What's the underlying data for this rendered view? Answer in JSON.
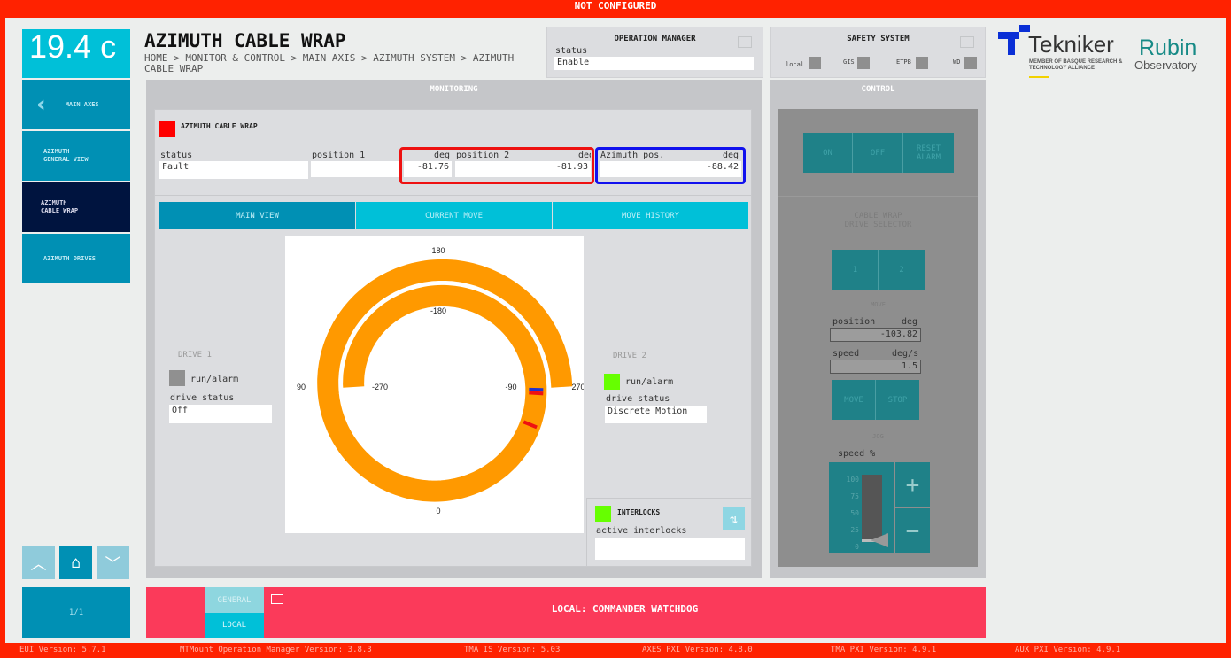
{
  "status_banner": "NOT CONFIGURED",
  "temperature": "19.4 c",
  "sidebar": {
    "items": [
      {
        "label": "MAIN AXES",
        "icon": "chevron-left-icon"
      },
      {
        "label": "AZIMUTH\nGENERAL VIEW"
      },
      {
        "label": "AZIMUTH\nCABLE WRAP",
        "active": true
      },
      {
        "label": "AZIMUTH DRIVES"
      }
    ]
  },
  "header": {
    "title": "AZIMUTH CABLE WRAP",
    "breadcrumb": "HOME > MONITOR & CONTROL > MAIN AXIS > AZIMUTH SYSTEM > AZIMUTH CABLE WRAP"
  },
  "operation_manager": {
    "title": "OPERATION MANAGER",
    "status_label": "status",
    "status": "Enable"
  },
  "safety_system": {
    "title": "SAFETY SYSTEM",
    "indicators": [
      "local",
      "GIS",
      "ETPB",
      "WD"
    ]
  },
  "monitoring": {
    "title": "MONITORING",
    "section_title": "AZIMUTH CABLE WRAP",
    "section_color": "#ff0000",
    "status_label": "status",
    "status": "Fault",
    "position1_label": "position 1",
    "position1_unit": "deg",
    "position1": "-81.76",
    "position2_label": "position 2",
    "position2_unit": "deg",
    "position2": "-81.93",
    "azimuth_label": "Azimuth pos.",
    "azimuth_unit": "deg",
    "azimuth": "-88.42",
    "tabs": [
      "MAIN VIEW",
      "CURRENT MOVE",
      "MOVE HISTORY"
    ],
    "gauge": {
      "labels": {
        "outer_top": "180",
        "outer_left": "90",
        "outer_right": "270",
        "bottom": "0",
        "inner_top": "-180",
        "inner_left": "-270",
        "inner_right": "-90"
      },
      "ring_color": "#ff9900",
      "range": [
        -270,
        270
      ],
      "position1": -81.76,
      "position2": -81.93,
      "azimuth": -88.42
    },
    "drive1": {
      "title": "DRIVE 1",
      "run_label": "run/alarm",
      "run_color": "#909090",
      "status_label": "drive status",
      "status": "Off"
    },
    "drive2": {
      "title": "DRIVE 2",
      "run_label": "run/alarm",
      "run_color": "#66ff00",
      "status_label": "drive status",
      "status": "Discrete Motion"
    },
    "interlocks": {
      "title": "INTERLOCKS",
      "color": "#66ff00",
      "active_label": "active interlocks",
      "active": ""
    }
  },
  "control": {
    "title": "CONTROL",
    "on": "ON",
    "off": "OFF",
    "reset": "RESET\nALARM",
    "selector_title": "CABLE WRAP\nDRIVE SELECTOR",
    "drive1": "1",
    "drive2": "2",
    "move_title": "MOVE",
    "position_label": "position",
    "position_unit": "deg",
    "position": "-103.82",
    "speed_label": "speed",
    "speed_unit": "deg/s",
    "speed": "1.5",
    "move": "MOVE",
    "stop": "STOP",
    "jog_title": "JOG",
    "jog_speed_label": "speed %",
    "jog_ticks": [
      "100",
      "75",
      "50",
      "25",
      "0"
    ],
    "jog_speed_percent": 0
  },
  "logos": {
    "tekniker": "Tekniker",
    "tekniker_sub": "MEMBER OF BASQUE RESEARCH & TECHNOLOGY ALLIANCE",
    "rubin": "Rubin",
    "rubin_sub": "Observatory"
  },
  "footer": {
    "page": "1/1",
    "general": "GENERAL",
    "local": "LOCAL",
    "message": "LOCAL: COMMANDER WATCHDOG"
  },
  "versions": [
    "EUI Version: 5.7.1",
    "MTMount Operation Manager Version: 3.8.3",
    "TMA IS Version: 5.03",
    "AXES PXI Version: 4.8.0",
    "TMA PXI Version: 4.9.1",
    "AUX PXI Version: 4.9.1"
  ]
}
